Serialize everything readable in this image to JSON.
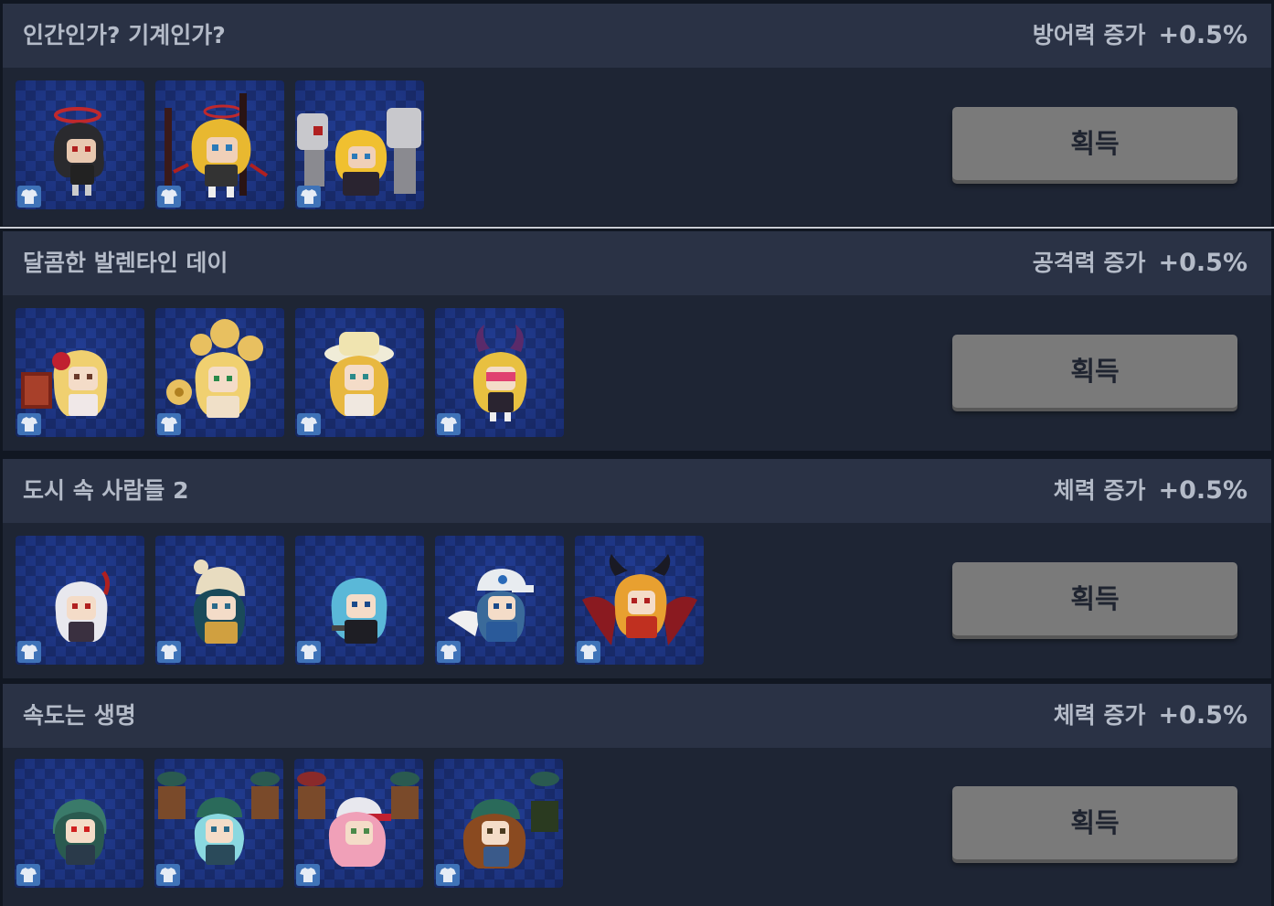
{
  "sets": [
    {
      "title": "인간인가? 기계인가?",
      "stat": "방어력 증가",
      "value": "+0.5%",
      "button": "획득",
      "items": [
        {
          "icon": "character-haloed-dark-hair-icon"
        },
        {
          "icon": "character-armored-blonde-icon"
        },
        {
          "icon": "character-mech-blonde-icon"
        }
      ]
    },
    {
      "title": "달콤한 발렌타인 데이",
      "stat": "공격력 증가",
      "value": "+0.5%",
      "button": "획득",
      "items": [
        {
          "icon": "character-rose-blonde-icon"
        },
        {
          "icon": "character-flower-crown-icon"
        },
        {
          "icon": "character-hat-blonde-icon"
        },
        {
          "icon": "character-horned-pink-icon"
        }
      ]
    },
    {
      "title": "도시 속 사람들 2",
      "stat": "체력 증가",
      "value": "+0.5%",
      "button": "획득",
      "items": [
        {
          "icon": "character-white-hair-icon"
        },
        {
          "icon": "character-knit-hat-icon"
        },
        {
          "icon": "character-blue-hair-icon"
        },
        {
          "icon": "character-cap-blue-icon"
        },
        {
          "icon": "character-dragon-wings-icon"
        }
      ]
    },
    {
      "title": "속도는 생명",
      "stat": "체력 증가",
      "value": "+0.5%",
      "button": "획득",
      "items": [
        {
          "icon": "character-helmet-red-eyes-icon"
        },
        {
          "icon": "character-green-cap-icon"
        },
        {
          "icon": "character-pink-hair-cap-icon"
        },
        {
          "icon": "character-brown-hair-cap-icon"
        }
      ]
    }
  ],
  "colors": {
    "panel_bg": "#1e2534",
    "header_bg": "#2a3245",
    "text": "#b4bbc8",
    "button_bg": "#7a7a7a",
    "tile_bg": "#1b2e70",
    "shirt_badge": "#3f73b8"
  }
}
